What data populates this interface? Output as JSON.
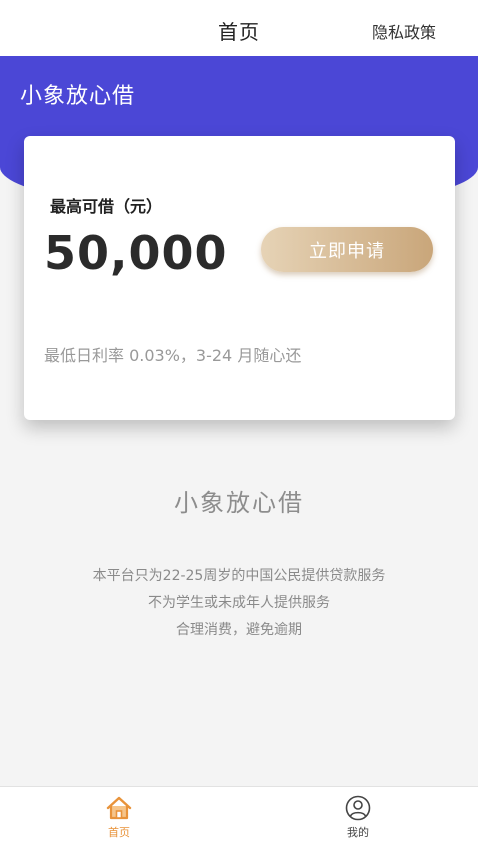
{
  "header": {
    "title": "首页",
    "privacy_link": "隐私政策"
  },
  "hero": {
    "brand": "小象放心借",
    "color": "#4b47d6"
  },
  "card": {
    "label": "最高可借（元）",
    "amount": "50,000",
    "apply_button": "立即申请",
    "rate_text": "最低日利率 0.03%，3-24 月随心还"
  },
  "about": {
    "slogan": "小象放心借",
    "lines": [
      "本平台只为22-25周岁的中国公民提供贷款服务",
      "不为学生或未成年人提供服务",
      "合理消费，避免逾期"
    ]
  },
  "tabbar": {
    "items": [
      {
        "label": "首页",
        "icon": "home-icon",
        "active": true
      },
      {
        "label": "我的",
        "icon": "user-icon",
        "active": false
      }
    ],
    "active_color": "#e8933a"
  }
}
